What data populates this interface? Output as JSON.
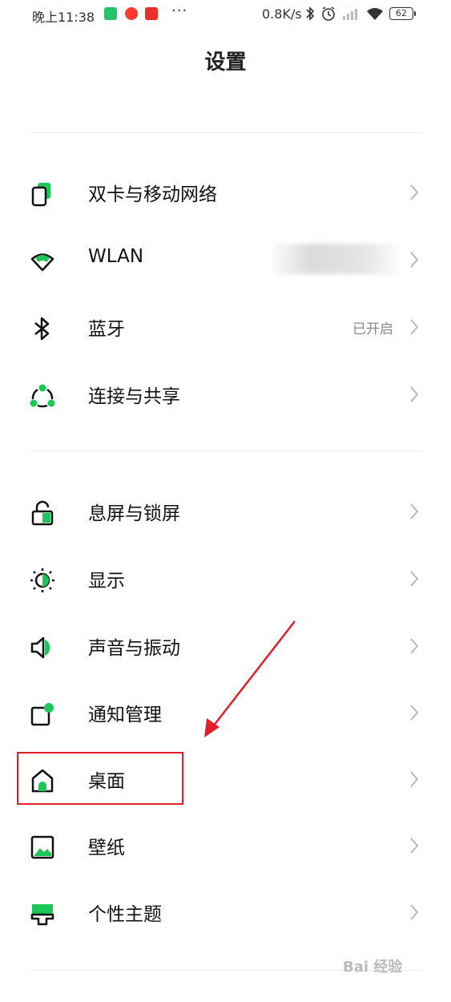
{
  "status_bar": {
    "time": "晚上11:38",
    "more": "···",
    "speed": "0.8K/s",
    "battery": "62",
    "icons": [
      "app-icon-green",
      "app-icon-red-play",
      "app-icon-red-news",
      "bluetooth-icon",
      "alarm-icon",
      "signal-icon",
      "wifi-icon",
      "battery-icon"
    ]
  },
  "header": {
    "title": "设置"
  },
  "sections": [
    {
      "items": [
        {
          "label": "双卡与移动网络",
          "icon": "sim-card-icon",
          "value": ""
        },
        {
          "label": "WLAN",
          "icon": "wifi-icon",
          "value": ""
        },
        {
          "label": "蓝牙",
          "icon": "bluetooth-icon",
          "value": "已开启"
        },
        {
          "label": "连接与共享",
          "icon": "share-icon",
          "value": ""
        }
      ]
    },
    {
      "items": [
        {
          "label": "息屏与锁屏",
          "icon": "lock-icon",
          "value": ""
        },
        {
          "label": "显示",
          "icon": "brightness-icon",
          "value": ""
        },
        {
          "label": "声音与振动",
          "icon": "speaker-icon",
          "value": ""
        },
        {
          "label": "通知管理",
          "icon": "notification-icon",
          "value": ""
        },
        {
          "label": "桌面",
          "icon": "home-icon",
          "value": ""
        },
        {
          "label": "壁纸",
          "icon": "wallpaper-icon",
          "value": ""
        },
        {
          "label": "个性主题",
          "icon": "theme-icon",
          "value": ""
        }
      ]
    }
  ],
  "watermark": "Bai 经验",
  "colors": {
    "accent": "#1ec65a",
    "annotation": "#e0202a"
  }
}
